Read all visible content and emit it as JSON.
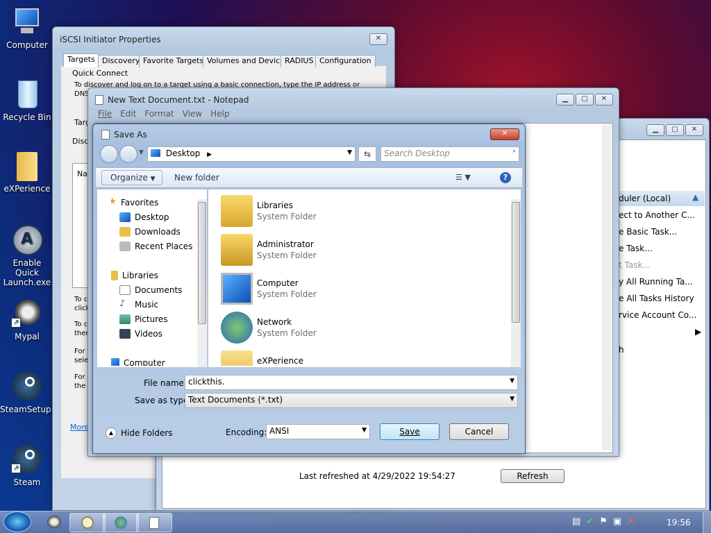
{
  "desktop": {
    "icons": [
      "Computer",
      "Recycle Bin",
      "eXPerience",
      "Enable Quick Launch.exe",
      "Mypal",
      "SteamSetup....",
      "Steam"
    ]
  },
  "iscsi": {
    "title": "iSCSI Initiator Properties",
    "tabs": [
      "Targets",
      "Discovery",
      "Favorite Targets",
      "Volumes and Devices",
      "RADIUS",
      "Configuration"
    ],
    "quick_connect": "Quick Connect",
    "qc_text1": "To discover and log on to a target using a basic connection, type the IP address or",
    "qc_text2": "DNS",
    "targ": "Targ",
    "disco": "Disco",
    "na": "Na",
    "frag": [
      "To c",
      "click",
      "To c",
      "ther",
      "For",
      "sele",
      "For",
      "the"
    ],
    "more": "More"
  },
  "notepad": {
    "title": "New Text Document.txt - Notepad",
    "menu": [
      "File",
      "Edit",
      "Format",
      "View",
      "Help"
    ]
  },
  "scheduler": {
    "header": "duler (Local)",
    "items": [
      "ect to Another C...",
      "e Basic Task...",
      "e Task...",
      "t Task...",
      "y All Running Ta...",
      "e All Tasks History",
      "rvice Account Co...",
      "",
      "h"
    ],
    "last_refreshed": "Last refreshed at 4/29/2022 19:54:27",
    "refresh": "Refresh",
    "frag8": "8"
  },
  "saveas": {
    "title": "Save As",
    "location": "Desktop",
    "search_placeholder": "Search Desktop",
    "organize": "Organize",
    "new_folder": "New folder",
    "nav": {
      "favorites": "Favorites",
      "fav_items": [
        "Desktop",
        "Downloads",
        "Recent Places"
      ],
      "libraries": "Libraries",
      "lib_items": [
        "Documents",
        "Music",
        "Pictures",
        "Videos"
      ],
      "computer": "Computer"
    },
    "files": [
      {
        "name": "Libraries",
        "type": "System Folder"
      },
      {
        "name": "Administrator",
        "type": "System Folder"
      },
      {
        "name": "Computer",
        "type": "System Folder"
      },
      {
        "name": "Network",
        "type": "System Folder"
      },
      {
        "name": "eXPerience",
        "type": ""
      }
    ],
    "file_name_label": "File name:",
    "file_name_value": "clickthis.",
    "save_type_label": "Save as type:",
    "save_type_value": "Text Documents (*.txt)",
    "hide_folders": "Hide Folders",
    "encoding_label": "Encoding:",
    "encoding_value": "ANSI",
    "save": "Save",
    "cancel": "Cancel"
  },
  "taskbar": {
    "clock": "19:56"
  }
}
